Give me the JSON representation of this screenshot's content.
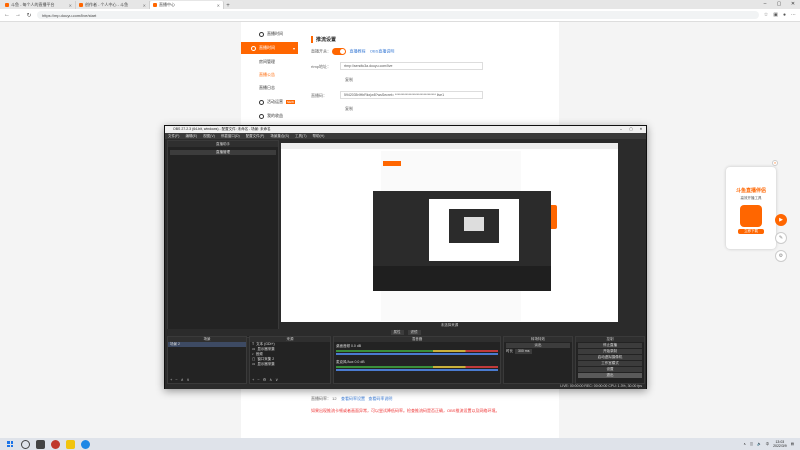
{
  "browser": {
    "tabs": [
      {
        "label": "斗鱼 - 每个人的直播平台"
      },
      {
        "label": "创作者 - 个人中心 - 斗鱼"
      },
      {
        "label": "直播中心"
      }
    ],
    "url": "https://mp.douyu.com/live/start",
    "new_tab": "+"
  },
  "sidebar": {
    "items": [
      {
        "label": "直播时间",
        "active": false
      },
      {
        "label": "直播时间",
        "active": true
      },
      {
        "label": "房间管理",
        "active": false
      },
      {
        "label": "直播公告",
        "active": false,
        "highlight": true
      },
      {
        "label": "直播日志",
        "active": false
      },
      {
        "label": "活动运营",
        "active": false
      },
      {
        "label": "我的收益",
        "active": false
      }
    ]
  },
  "stream": {
    "section_title": "推流设置",
    "toggle_label": "直播开关：",
    "toggle_link1": "直播教程",
    "toggle_link2": "OBS直播说明",
    "rtmp_label": "rtmp地址：",
    "rtmp_value": "rtmp://sendtc3a.douyu.com/live",
    "copy1": "复制",
    "code_label": "直播码：",
    "code_value": "5942035rIHbRkx|w8?wsSecret= ****************************** live1",
    "copy2": "复制"
  },
  "bottom": {
    "quality_label": "直播码率：",
    "quality_value": "12",
    "link1": "查看码率设置",
    "link2": "查看码率说明",
    "warning": "如果出现推流卡顿或者画面异常，可以尝试降低码率。检查推流码是否正确，OBS推流设置以及网络环境。"
  },
  "widget": {
    "title": "斗鱼直播伴侣",
    "subtitle": "高效开播工具",
    "button": "立即下载"
  },
  "obs": {
    "title": "OBS 27.2.3 (64-bit, windows) - 配置文件: 未命名 - 场景: 未命名",
    "menu": [
      "文件(F)",
      "编辑(E)",
      "视图(V)",
      "停靠窗口(D)",
      "配置文件(P)",
      "场景集合(S)",
      "工具(T)",
      "帮助(H)"
    ],
    "dock_header": "直播助手",
    "dock_button": "直播管理",
    "preview_label": "未选择来源",
    "ctrl_props": "属性",
    "ctrl_filters": "滤镜",
    "scenes": {
      "header": "场景",
      "items": [
        "场景 2"
      ]
    },
    "sources": {
      "header": "来源",
      "items": [
        "文本 (GDI+)",
        "显示器采集",
        "音频",
        "窗口采集 2",
        "显示器采集"
      ]
    },
    "mixer": {
      "header": "混音器",
      "channels": [
        {
          "name": "桌面音频",
          "db": "0.0 dB"
        },
        {
          "name": "麦克风/Aux",
          "db": "0.0 dB"
        }
      ]
    },
    "transitions": {
      "header": "转场特效",
      "type": "淡出",
      "duration_label": "时长",
      "duration": "300 ms"
    },
    "controls": {
      "header": "控制",
      "buttons": [
        "停止直播",
        "开始录制",
        "启动虚拟摄像机",
        "工作室模式",
        "设置",
        "退出"
      ]
    },
    "status": "LIVE: 00:00:00    REC: 00:00:00    CPU: 1.3%, 30.00 fps"
  },
  "taskbar": {
    "time": "13:03",
    "date": "2022/3/9",
    "lang": "中"
  }
}
